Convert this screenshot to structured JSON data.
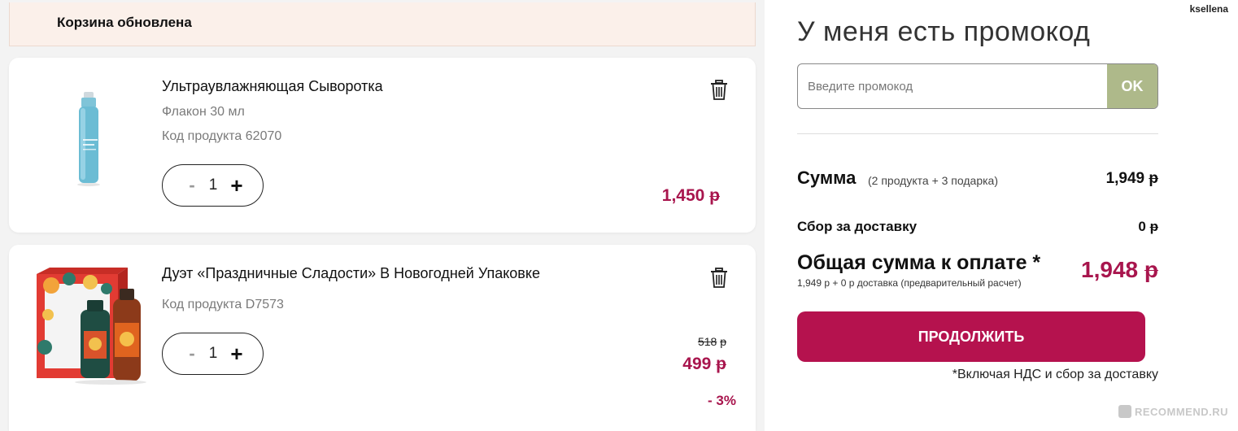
{
  "header": {
    "username": "ksellena"
  },
  "banner": {
    "message": "Корзина обновлена"
  },
  "cart": {
    "items": [
      {
        "title": "Ультраувлажняющая Сыворотка",
        "volume": "Флакон 30 мл",
        "code": "Код продукта 62070",
        "quantity": "1",
        "price_amount": "1,450",
        "currency": "р"
      },
      {
        "title": "Дуэт «Праздничные Сладости» В Новогодней Упаковке",
        "code": "Код продукта D7573",
        "quantity": "1",
        "old_price_amount": "518",
        "price_amount": "499",
        "currency": "р",
        "discount": "- 3%"
      }
    ],
    "minus_symbol": "-",
    "plus_symbol": "+"
  },
  "promo": {
    "title": "У меня есть промокод",
    "placeholder": "Введите промокод",
    "ok_label": "OK"
  },
  "summary": {
    "sum_label": "Сумма",
    "sum_detail": "(2 продукта + 3 подарка)",
    "sum_amount": "1,949",
    "shipping_label": "Сбор за доставку",
    "shipping_amount": "0",
    "total_label": "Общая сумма к оплате *",
    "total_detail": "1,949 р + 0 р доставка (предварительный расчет)",
    "total_amount": "1,948",
    "currency": "р",
    "continue_label": "ПРОДОЛЖИТЬ",
    "vat_note": "*Включая НДС и сбор за доставку"
  },
  "watermark": {
    "text": "RECOMMEND.RU"
  },
  "colors": {
    "accent": "#b5124e",
    "price": "#a8154d",
    "promo_button": "#aeb98a",
    "banner_bg": "#fbf0ea"
  },
  "icons": [
    "trash-icon",
    "serum-bottle-image",
    "gift-set-image"
  ]
}
